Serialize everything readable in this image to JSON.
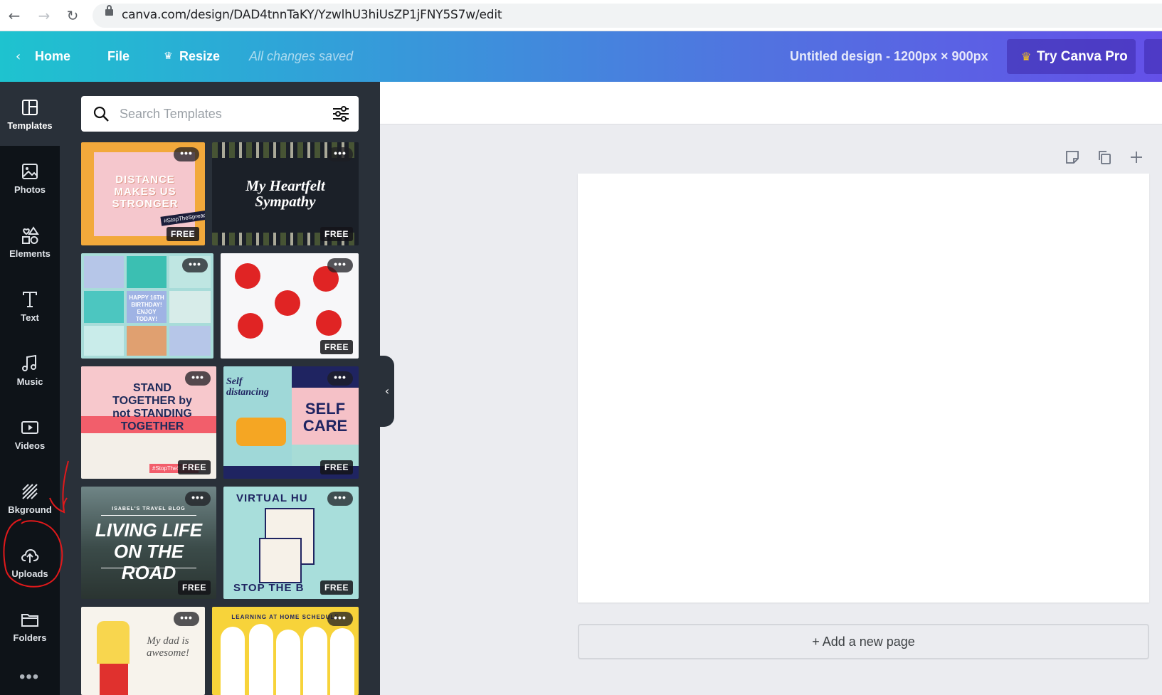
{
  "browser": {
    "url": "canva.com/design/DAD4tnnTaKY/YzwlhU3hiUsZP1jFNY5S7w/edit"
  },
  "toolbar": {
    "home_label": "Home",
    "file_label": "File",
    "resize_label": "Resize",
    "saved_status": "All changes saved",
    "design_title": "Untitled design - 1200px × 900px",
    "pro_label": "Try Canva Pro"
  },
  "sidebar": {
    "items": [
      {
        "label": "Templates",
        "icon": "templates-icon"
      },
      {
        "label": "Photos",
        "icon": "photos-icon"
      },
      {
        "label": "Elements",
        "icon": "elements-icon"
      },
      {
        "label": "Text",
        "icon": "text-icon"
      },
      {
        "label": "Music",
        "icon": "music-icon"
      },
      {
        "label": "Videos",
        "icon": "videos-icon"
      },
      {
        "label": "Bkground",
        "icon": "background-icon"
      },
      {
        "label": "Uploads",
        "icon": "upload-cloud-icon"
      },
      {
        "label": "Folders",
        "icon": "folder-icon"
      }
    ],
    "more_label": "•••"
  },
  "search": {
    "placeholder": "Search Templates"
  },
  "templates": [
    {
      "text": "DISTANCE\nMAKES US\nSTRONGER",
      "free": "FREE",
      "tag": "#StopTheSpread"
    },
    {
      "text": "My Heartfelt Sympathy",
      "free": "FREE"
    },
    {
      "text": "HAPPY 16TH BIRTHDAY! ENJOY TODAY!"
    },
    {
      "text": "",
      "free": "FREE"
    },
    {
      "text": "STAND TOGETHER by not STANDING TOGETHER",
      "free": "FREE",
      "tag": "#StopTheSpread"
    },
    {
      "text": "SELF CARE",
      "free": "FREE",
      "script": "Self distancing"
    },
    {
      "text": "LIVING LIFE ON THE ROAD",
      "free": "FREE",
      "kicker": "ISABEL'S TRAVEL BLOG"
    },
    {
      "text": "VIRTUAL HU",
      "free": "FREE",
      "bottom": "STOP THE B"
    },
    {
      "text": "My dad is awesome!"
    },
    {
      "text": "LEARNING AT HOME SCHEDULE"
    }
  ],
  "canvas": {
    "add_page_label": "+ Add a new page"
  },
  "colors": {
    "accent_from": "#1ec3cf",
    "accent_to": "#6450e8",
    "rail_bg": "#0e1318",
    "panel_bg": "#293039",
    "annotation": "#e0191b"
  }
}
